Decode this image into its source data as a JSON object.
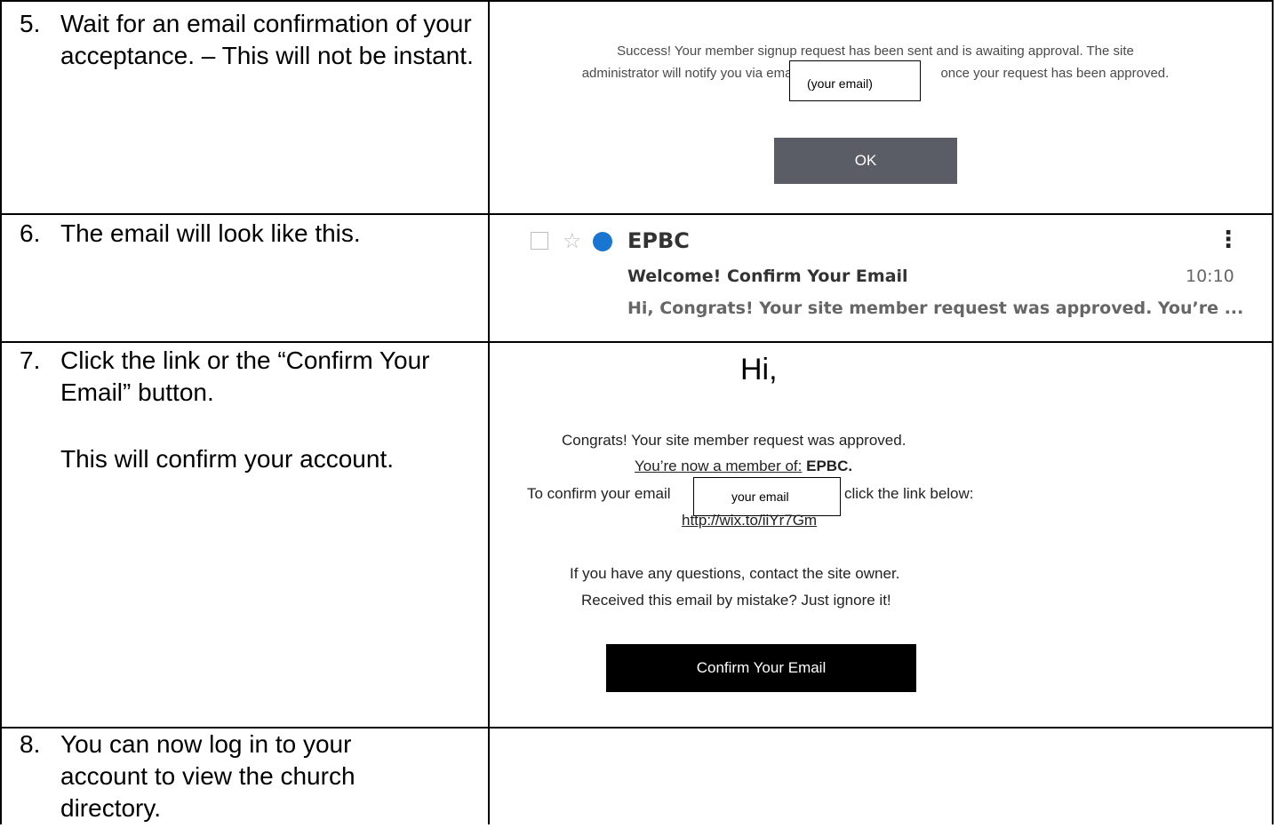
{
  "steps": [
    {
      "num": "5.",
      "text": "Wait for an email confirmation of your acceptance. – This will not be instant."
    },
    {
      "num": "6.",
      "text": "The email will look like this."
    },
    {
      "num": "7.",
      "text": "Click the link or the “Confirm Your Email” button.",
      "text2": "This will confirm your account."
    },
    {
      "num": "8.",
      "text": "You can now log in to your account to view the church directory."
    }
  ],
  "success_dialog": {
    "message_line1": "Success! Your member signup request has been sent and is awaiting approval. The site",
    "message_line2_a": "administrator will notify you via email",
    "email_placeholder": "(your email)",
    "message_line2_b": "once your request has been approved.",
    "ok_label": "OK"
  },
  "inbox": {
    "sender": "EPBC",
    "subject": "Welcome! Confirm Your Email",
    "time": "10:10",
    "preview": "Hi, Congrats! Your site member request was approved. You’re ...",
    "more_icon": "⋮",
    "star_icon": "☆",
    "unread_color": "#1875d1"
  },
  "email_body": {
    "greeting": "Hi,",
    "line1": "Congrats! Your site member request was approved.",
    "line2_a": "You’re now a member of:",
    "line2_b": "EPBC.",
    "line3_a": "To confirm your email",
    "email_placeholder": "your email",
    "line3_b": "click the link below:",
    "link": "http://wix.to/iiYr7Gm",
    "line5": "If you have any questions, contact the site owner.",
    "line6": "Received this email by mistake? Just ignore it!",
    "confirm_label": "Confirm Your Email"
  }
}
